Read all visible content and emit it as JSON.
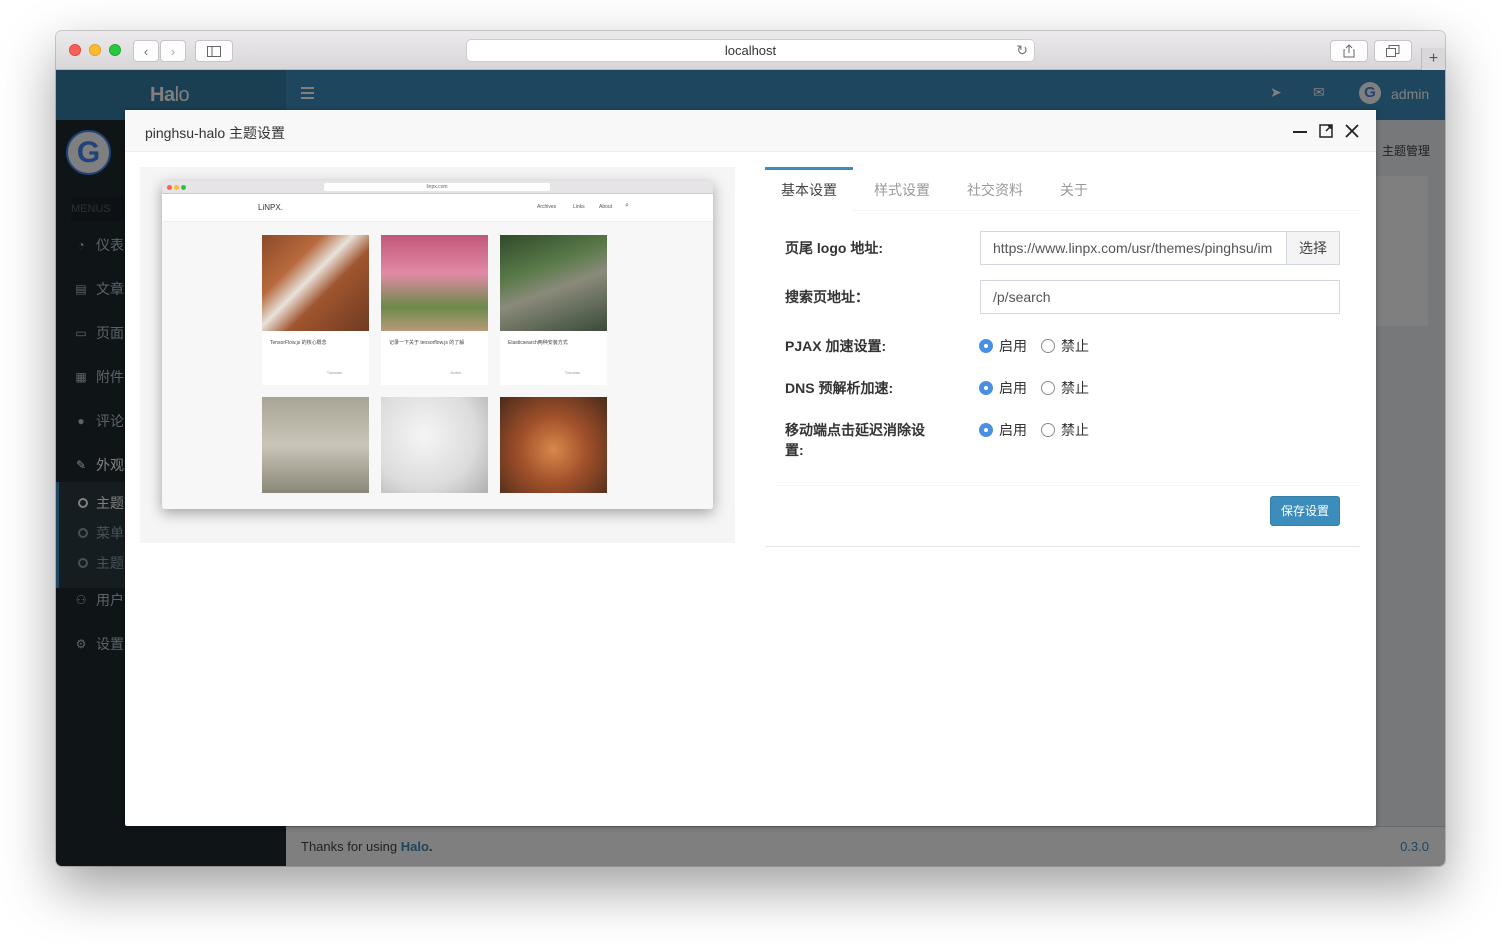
{
  "browser": {
    "url": "localhost"
  },
  "admin": {
    "logo_main": "Ha",
    "logo_rest": "lo",
    "user": "admin",
    "menus_header": "MENUS",
    "menu": [
      {
        "label": "仪表",
        "icon": "dashboard-icon"
      },
      {
        "label": "文章",
        "icon": "book-icon"
      },
      {
        "label": "页面",
        "icon": "desktop-icon"
      },
      {
        "label": "附件",
        "icon": "image-icon"
      },
      {
        "label": "评论",
        "icon": "comment-icon"
      },
      {
        "label": "外观",
        "icon": "brush-icon"
      }
    ],
    "submenu": [
      "主题",
      "菜单",
      "主题"
    ],
    "menu_after": [
      {
        "label": "用户",
        "icon": "user-icon"
      },
      {
        "label": "设置",
        "icon": "gear-icon"
      }
    ],
    "breadcrumb_tail": "主题管理",
    "footer_text": "Thanks for using ",
    "footer_link": "Halo",
    "footer_dot": ".",
    "version": "0.3.0"
  },
  "modal": {
    "title": "pinghsu-halo 主题设置",
    "tabs": [
      "基本设置",
      "样式设置",
      "社交资料",
      "关于"
    ],
    "active_tab": "基本设置",
    "fields": {
      "footer_logo_label": "页尾 logo 地址:",
      "footer_logo_value": "https://www.linpx.com/usr/themes/pinghsu/im",
      "footer_logo_button": "选择",
      "search_label": "搜索页地址：",
      "search_value": "/p/search",
      "pjax_label": "PJAX 加速设置:",
      "dns_label": "DNS 预解析加速:",
      "mobile_label_1": "移动端点击延迟消除设",
      "mobile_label_2": "置:",
      "enable": "启用",
      "disable": "禁止"
    },
    "radios": {
      "pjax": "enable",
      "dns": "enable",
      "mobile": "enable"
    },
    "save_button": "保存设置"
  },
  "preview": {
    "site_logo": "LiNPX.",
    "url": "linpx.com",
    "nav": [
      "Archives",
      "Links",
      "About"
    ],
    "cards": [
      {
        "title": "TensorFlow.js 的核心概念",
        "tag": "Tutorials"
      },
      {
        "title": "记录一下关于 tensorflow.js 的了解",
        "tag": "Notes"
      },
      {
        "title": "Elasticsearch两种安装方式",
        "tag": "Tutorials"
      }
    ]
  },
  "colors": {
    "accent": "#3c8dbc",
    "sidebar": "#1e282c",
    "radio_on": "#4a90e2"
  }
}
